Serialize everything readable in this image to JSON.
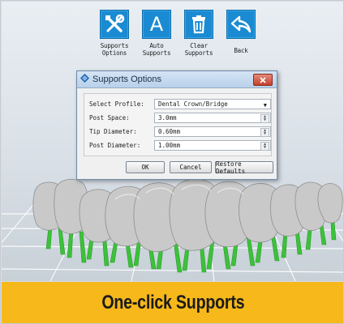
{
  "toolbar": {
    "items": [
      {
        "label": "Supports\nOptions",
        "icon": "tools-icon"
      },
      {
        "label": "Auto\nSupports",
        "icon": "letter-a-icon",
        "glyph": "A"
      },
      {
        "label": "Clear\nSupports",
        "icon": "trash-icon"
      },
      {
        "label": "Back",
        "icon": "back-arrow-icon"
      }
    ]
  },
  "dialog": {
    "title": "Supports Options",
    "fields": [
      {
        "label": "Select Profile:",
        "value": "Dental Crown/Bridge",
        "kind": "select"
      },
      {
        "label": "Post Space:",
        "value": "3.0mm",
        "kind": "spinner"
      },
      {
        "label": "Tip Diameter:",
        "value": "0.60mm",
        "kind": "spinner"
      },
      {
        "label": "Post Diameter:",
        "value": "1.00mm",
        "kind": "spinner"
      }
    ],
    "buttons": {
      "ok": "OK",
      "cancel": "Cancel",
      "restore": "Restore Defaults"
    }
  },
  "banner": {
    "text": "One-click Supports"
  },
  "colors": {
    "accent": "#1a8bd2",
    "banner": "#f6b81a",
    "support": "#3cc23a",
    "model": "#c9c9c9"
  }
}
